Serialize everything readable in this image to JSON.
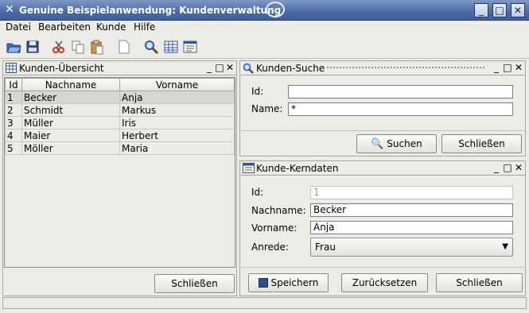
{
  "window": {
    "title": "Genuine Beispielanwendung: Kundenverwaltung"
  },
  "menu": [
    "Datei",
    "Bearbeiten",
    "Kunde",
    "Hilfe"
  ],
  "toolbar": [
    "open-icon",
    "save-icon",
    "cut-icon",
    "copy-icon",
    "paste-icon",
    "new-document-icon",
    "search-icon",
    "table-icon",
    "form-icon"
  ],
  "overview": {
    "title": "Kunden-Übersicht",
    "columns": [
      "Id",
      "Nachname",
      "Vorname"
    ],
    "rows": [
      [
        "1",
        "Becker",
        "Anja"
      ],
      [
        "2",
        "Schmidt",
        "Markus"
      ],
      [
        "3",
        "Müller",
        "Iris"
      ],
      [
        "4",
        "Maier",
        "Herbert"
      ],
      [
        "5",
        "Möller",
        "Maria"
      ]
    ],
    "close_label": "Schließen"
  },
  "search": {
    "title": "Kunden-Suche",
    "id_label": "Id:",
    "id_value": "",
    "name_label": "Name:",
    "name_value": "*",
    "search_label": "Suchen",
    "close_label": "Schließen"
  },
  "details": {
    "title": "Kunde-Kerndaten",
    "id_label": "Id:",
    "id_value": "1",
    "lastname_label": "Nachname:",
    "lastname_value": "Becker",
    "firstname_label": "Vorname:",
    "firstname_value": "Anja",
    "salutation_label": "Anrede:",
    "salutation_value": "Frau",
    "save_label": "Speichern",
    "reset_label": "Zurücksetzen",
    "close_label": "Schließen"
  }
}
